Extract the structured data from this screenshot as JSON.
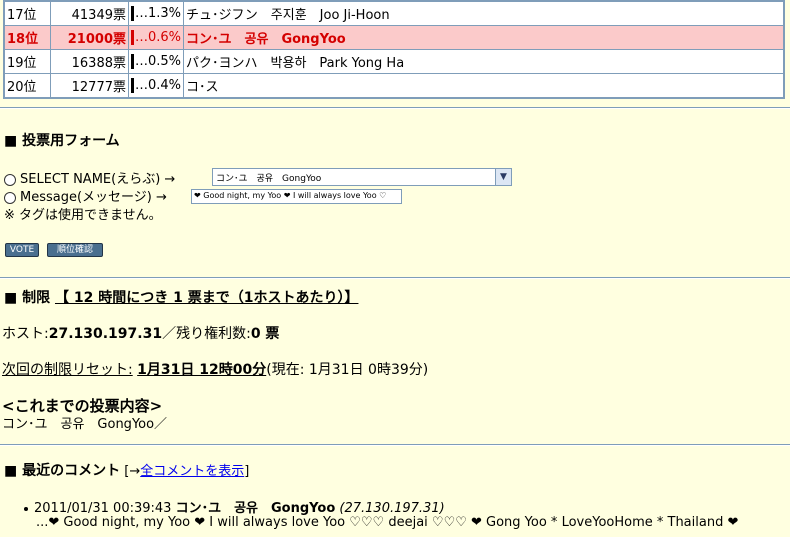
{
  "ranking": [
    {
      "rank": "17位",
      "votes": "41349票",
      "pct": "1.3%",
      "name": "チュ･ジフン　주지훈　Joo Ji-Hoon"
    },
    {
      "rank": "18位",
      "votes": "21000票",
      "pct": "0.6%",
      "name": "コン･ユ　공유　GongYoo"
    },
    {
      "rank": "19位",
      "votes": "16388票",
      "pct": "0.5%",
      "name": "パク･ヨンハ　박용하　Park Yong Ha"
    },
    {
      "rank": "20位",
      "votes": "12777票",
      "pct": "0.4%",
      "name": "コ･ス"
    }
  ],
  "vote_form": {
    "title": "■ 投票用フォーム",
    "select_label": "SELECT NAME(えらぶ) →",
    "select_value": "コン･ユ　공유　GongYoo",
    "message_label": "Message(メッセージ) →",
    "message_value": "❤ Good night, my Yoo ❤ I will always love Yoo ♡",
    "note": "※ タグは使用できません。",
    "vote_button": "VOTE",
    "confirm_button": "順位確認"
  },
  "limits": {
    "title_prefix": "■ 制限",
    "title_rule": "【 12 時間につき 1 票まで（1ホストあたり）】",
    "host_label": "ホスト:",
    "host_value": "27.130.197.31",
    "remaining_label": "／残り権利数:",
    "remaining_value": "0 票",
    "reset_label": "次回の制限リセット:",
    "reset_value": "1月31日 12時00分",
    "now_text": "(現在: 1月31日 0時39分)",
    "history_title": "<これまでの投票内容>",
    "history_value": "コン･ユ　공유　GongYoo／"
  },
  "comments": {
    "title": "■ 最近のコメント",
    "bracket_open": "[→",
    "show_all_link": "全コメントを表示",
    "bracket_close": "]",
    "items": [
      {
        "timestamp": "2011/01/31 00:39:43",
        "name": "コン･ユ　공유　GongYoo",
        "host": "(27.130.197.31)",
        "text": "...❤ Good night, my Yoo ❤ I will always love Yoo ♡♡♡ deejai ♡♡♡ ❤ Gong Yoo * LoveYooHome * Thailand ❤"
      }
    ]
  }
}
